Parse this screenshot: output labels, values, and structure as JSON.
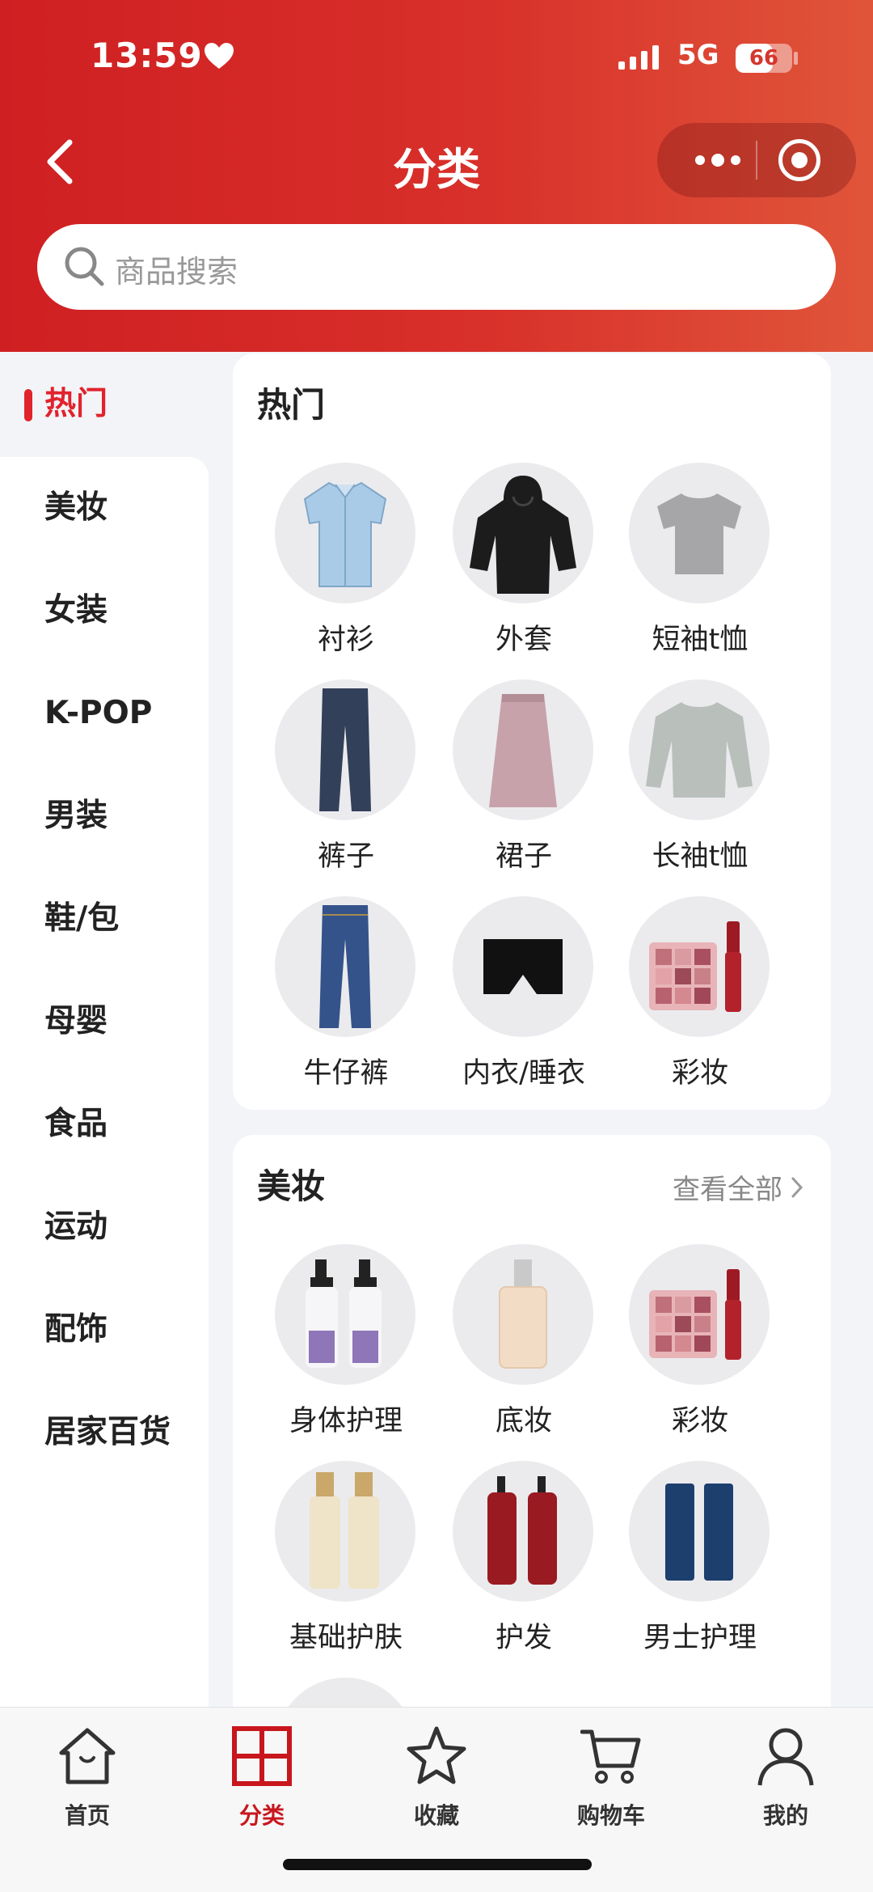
{
  "status_bar": {
    "time": "13:59",
    "network": "5G",
    "battery": "66",
    "battery_level": 0.66
  },
  "header": {
    "title": "分类"
  },
  "search": {
    "placeholder": "商品搜索"
  },
  "sidebar": {
    "active": "热门",
    "items": [
      "热门",
      "美妆",
      "女装",
      "K-POP",
      "男装",
      "鞋/包",
      "母婴",
      "食品",
      "运动",
      "配饰",
      "居家百货"
    ]
  },
  "sections": [
    {
      "title": "热门",
      "items": [
        {
          "label": "衬衫",
          "icon": "shirt-icon"
        },
        {
          "label": "外套",
          "icon": "jacket-icon"
        },
        {
          "label": "短袖t恤",
          "icon": "tshirt-icon"
        },
        {
          "label": "裤子",
          "icon": "pants-icon"
        },
        {
          "label": "裙子",
          "icon": "skirt-icon"
        },
        {
          "label": "长袖t恤",
          "icon": "sweater-icon"
        },
        {
          "label": "牛仔裤",
          "icon": "jeans-icon"
        },
        {
          "label": "内衣/睡衣",
          "icon": "underwear-icon"
        },
        {
          "label": "彩妆",
          "icon": "makeup-icon"
        }
      ]
    },
    {
      "title": "美妆",
      "view_all": "查看全部",
      "items": [
        {
          "label": "身体护理",
          "icon": "bodycare-icon"
        },
        {
          "label": "底妆",
          "icon": "foundation-icon"
        },
        {
          "label": "彩妆",
          "icon": "makeup-icon"
        },
        {
          "label": "基础护肤",
          "icon": "skincare-icon"
        },
        {
          "label": "护发",
          "icon": "haircare-icon"
        },
        {
          "label": "男士护理",
          "icon": "mencare-icon"
        }
      ]
    }
  ],
  "tabbar": {
    "active": "分类",
    "items": [
      {
        "label": "首页",
        "icon": "home-icon"
      },
      {
        "label": "分类",
        "icon": "category-icon"
      },
      {
        "label": "收藏",
        "icon": "star-icon"
      },
      {
        "label": "购物车",
        "icon": "cart-icon"
      },
      {
        "label": "我的",
        "icon": "user-icon"
      }
    ]
  },
  "colors": {
    "brand_red": "#d8302a",
    "active_red": "#e1232c",
    "header_gradient_end": "#e0553a"
  }
}
